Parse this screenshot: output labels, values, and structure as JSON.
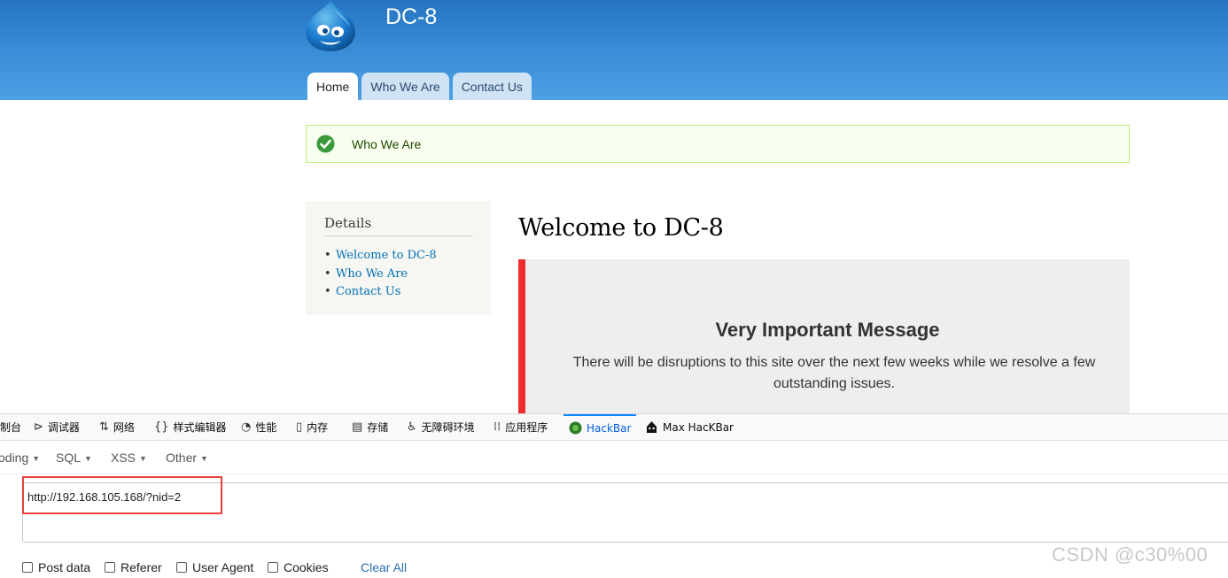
{
  "site": {
    "name": "DC-8",
    "nav": [
      {
        "label": "Home",
        "active": true
      },
      {
        "label": "Who We Are",
        "active": false
      },
      {
        "label": "Contact Us",
        "active": false
      }
    ],
    "status_message": "Who We Are",
    "sidebar": {
      "title": "Details",
      "links": [
        "Welcome to DC-8",
        "Who We Are",
        "Contact Us"
      ]
    },
    "page_title": "Welcome to DC-8",
    "notice": {
      "title": "Very Important Message",
      "body": "There will be disruptions to this site over the next few weeks while we resolve a few outstanding issues."
    },
    "colors": {
      "header_blue": "#2574c1",
      "link_blue": "#0071b3",
      "notice_red": "#ef2d2d",
      "status_green": "#3a9a3a"
    }
  },
  "devtools": {
    "tabs": [
      {
        "icon": "console-icon",
        "label": "制台"
      },
      {
        "icon": "debugger-icon",
        "label": "调试器"
      },
      {
        "icon": "network-icon",
        "label": "网络"
      },
      {
        "icon": "style-editor-icon",
        "label": "样式编辑器"
      },
      {
        "icon": "performance-icon",
        "label": "性能"
      },
      {
        "icon": "memory-icon",
        "label": "内存"
      },
      {
        "icon": "storage-icon",
        "label": "存储"
      },
      {
        "icon": "accessibility-icon",
        "label": "无障碍环境"
      },
      {
        "icon": "application-icon",
        "label": "应用程序"
      },
      {
        "icon": "hackbar-icon",
        "label": "HackBar",
        "active": true
      },
      {
        "icon": "max-hackbar-icon",
        "label": "Max HacKBar"
      }
    ],
    "hackbar": {
      "menu": [
        "oding",
        "SQL",
        "XSS",
        "Other"
      ],
      "url": "http://192.168.105.168/?nid=2",
      "options": [
        "Post data",
        "Referer",
        "User Agent",
        "Cookies"
      ],
      "clear_all": "Clear All"
    }
  },
  "watermark": "CSDN @c30%00"
}
